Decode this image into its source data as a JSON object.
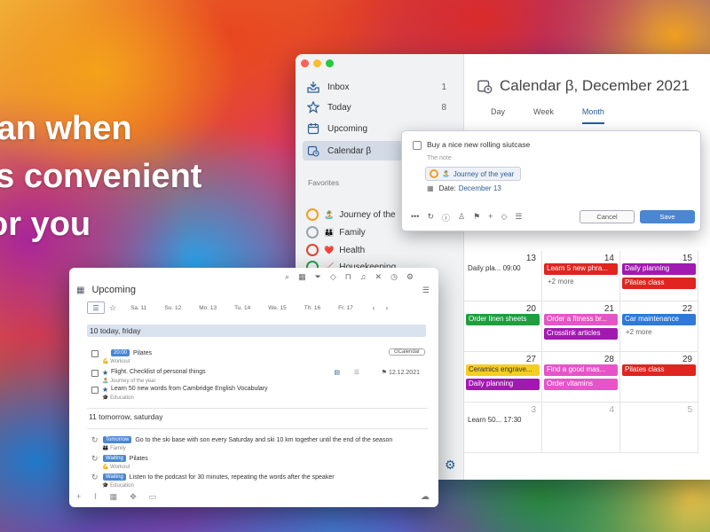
{
  "tagline": "lan when\n’s convenient\nor you",
  "colors": {
    "accent": "#2a5c95",
    "red": "#e0241f",
    "purple": "#a219b0",
    "green": "#1f9e3e",
    "blue": "#2f79d8",
    "yellow": "#f4cf20",
    "pink": "#e754c8",
    "magenta": "#b5148a"
  },
  "sidebar": {
    "items": [
      {
        "label": "Inbox",
        "count": "1",
        "icon": "inbox-icon"
      },
      {
        "label": "Today",
        "count": "8",
        "icon": "star-icon"
      },
      {
        "label": "Upcoming",
        "count": "",
        "icon": "calendar-icon"
      },
      {
        "label": "Calendar β",
        "count": "",
        "icon": "calendar-clock-icon"
      }
    ],
    "favorites_title": "Favorites",
    "favorites": [
      {
        "label": "Journey of the",
        "emoji": "🏝️",
        "circle": "#f0a020"
      },
      {
        "label": "Family",
        "emoji": "👪",
        "circle": "#9aa4ad"
      },
      {
        "label": "Health",
        "emoji": "❤️",
        "circle": "#e0452b"
      },
      {
        "label": "Housekeeping",
        "emoji": "🧹",
        "circle": "#2f9a4a"
      }
    ]
  },
  "calendar": {
    "title": "Calendar β, December 2021",
    "tabs": [
      "Day",
      "Week",
      "Month"
    ],
    "days": [
      {
        "num": "13",
        "events": [
          {
            "text": "Daily pla... 09:00",
            "style": "txt"
          }
        ]
      },
      {
        "num": "14",
        "events": [
          {
            "text": "Learn 5 new phra...",
            "color": "#e0241f"
          }
        ],
        "more": "+2 more"
      },
      {
        "num": "15",
        "events": [
          {
            "text": "Daily planning",
            "color": "#a219b0"
          },
          {
            "text": "Pilates class",
            "color": "#e0241f"
          }
        ]
      },
      {
        "num": "20",
        "events": [
          {
            "text": "Order linen sheets",
            "color": "#1f9e3e"
          }
        ]
      },
      {
        "num": "21",
        "events": [
          {
            "text": "Order a fitness br...",
            "color": "#e754c8"
          },
          {
            "text": "Crosslink articles",
            "color": "#a219b0"
          }
        ]
      },
      {
        "num": "22",
        "events": [
          {
            "text": "Car maintenance",
            "color": "#2f79d8"
          }
        ],
        "more": "+2 more"
      },
      {
        "num": "27",
        "events": [
          {
            "text": "Ceramics engrave...",
            "color": "#f4cf20",
            "textcolor": "#333"
          },
          {
            "text": "Daily planning",
            "color": "#a219b0"
          }
        ]
      },
      {
        "num": "28",
        "events": [
          {
            "text": "Find a good mas...",
            "color": "#e754c8"
          },
          {
            "text": "Order vitamins",
            "color": "#e754c8"
          }
        ]
      },
      {
        "num": "29",
        "events": [
          {
            "text": "Pilates class",
            "color": "#e0241f"
          }
        ]
      },
      {
        "num": "3",
        "dim": true,
        "events": [
          {
            "text": "Learn 50... 17:30",
            "style": "txt"
          }
        ]
      },
      {
        "num": "4",
        "dim": true,
        "events": []
      },
      {
        "num": "5",
        "dim": true,
        "events": []
      }
    ]
  },
  "popup": {
    "task": "Buy a nice new rolling siutcase",
    "note_placeholder": "The note",
    "project": "Journey of the year",
    "date_label": "Date:",
    "date_value": "December 13",
    "cancel": "Cancel",
    "save": "Save"
  },
  "upcoming": {
    "title": "Upcoming",
    "days": [
      "Sa. 11",
      "Su. 12",
      "Mo. 13",
      "Tu. 14",
      "We. 15",
      "Th. 16",
      "Fr. 17"
    ],
    "today_label": "10 today, friday",
    "today_tasks": [
      {
        "badge": "20:00",
        "title": "Pilates",
        "sub": "💪 Workout",
        "tag": "GCalendar"
      },
      {
        "star": true,
        "title": "Flight. Checklist of personal things",
        "sub": "🏝️ Journey of the year",
        "date": "12.12.2021"
      },
      {
        "star": true,
        "title": "Learn 50 new words from Cambridge English Vocabulary",
        "sub": "🎓 Education"
      }
    ],
    "tomorrow_label": "11 tomorrow, saturday",
    "tomorrow_tasks": [
      {
        "badge": "Tomorrow",
        "title": "Go to the ski base with son every Saturday and ski 10 km together until the end of the season",
        "sub": "👪 Family"
      },
      {
        "badge": "Waiting",
        "title": "Pilates",
        "sub": "💪 Workout"
      },
      {
        "badge": "Waiting",
        "title": "Listen to the podcast for 30 minutes, repeating the words after the speaker",
        "sub": "🎓 Education"
      }
    ]
  }
}
